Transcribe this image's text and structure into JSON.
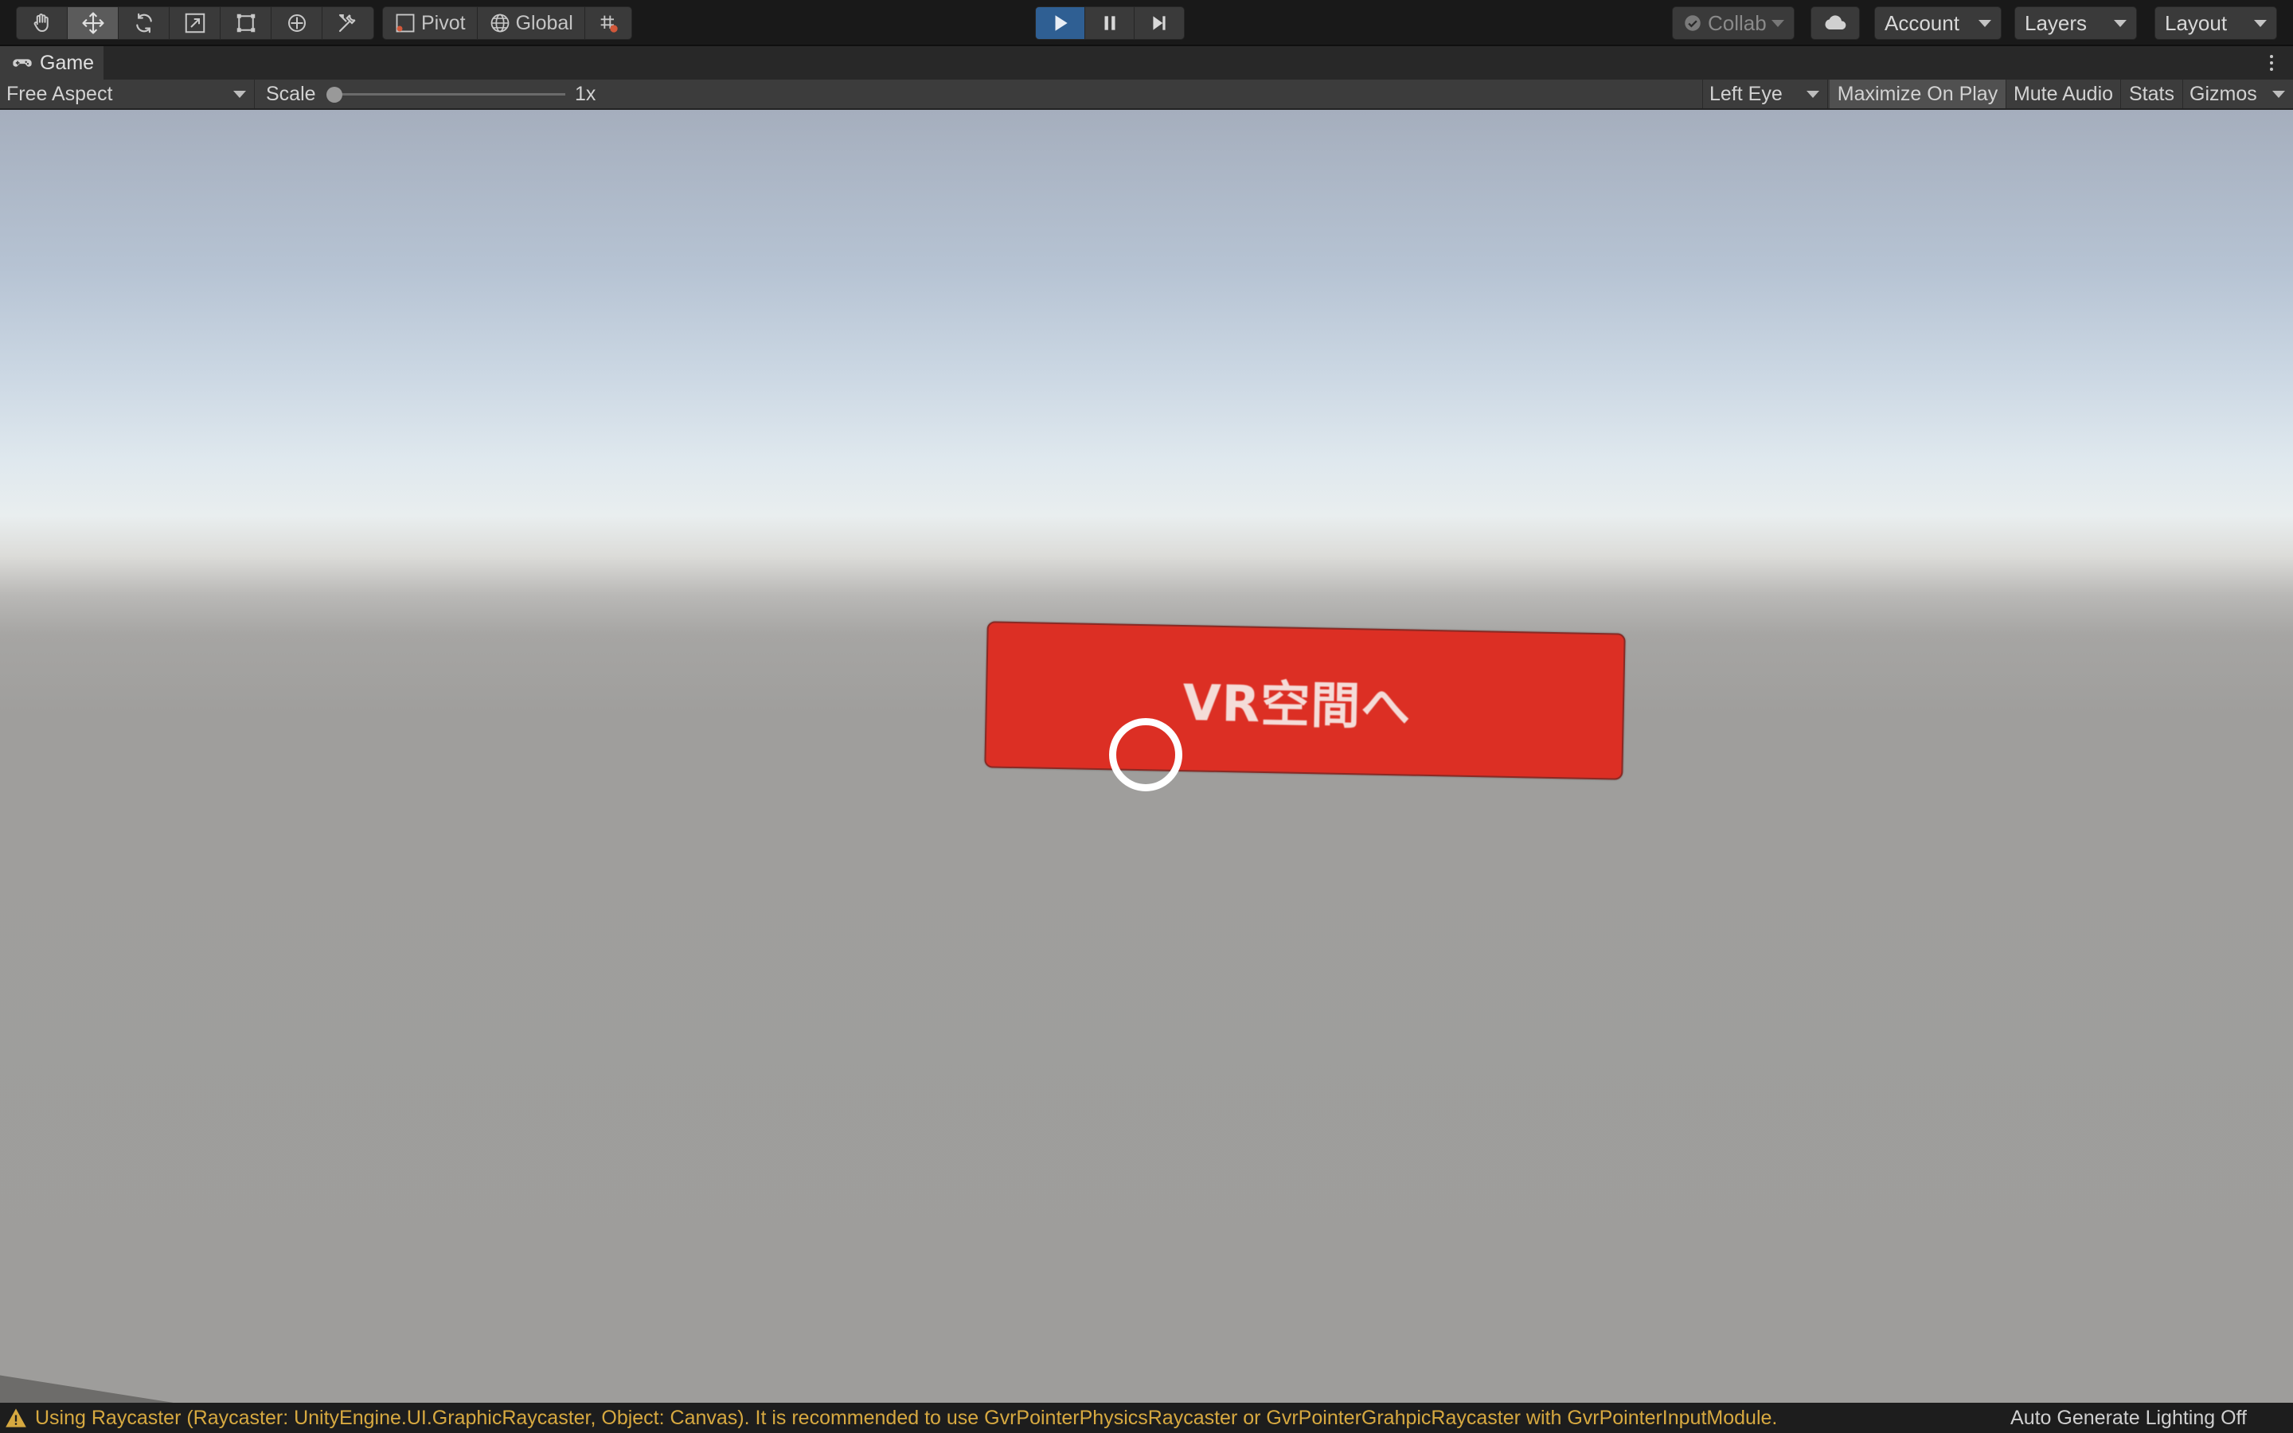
{
  "toolbar": {
    "tools": [
      "hand-tool",
      "move-tool",
      "rotate-tool",
      "scale-tool",
      "rect-tool",
      "transform-tool",
      "custom-tool"
    ],
    "pivot_label": "Pivot",
    "global_label": "Global",
    "collab_label": "Collab",
    "account_label": "Account",
    "layers_label": "Layers",
    "layout_label": "Layout",
    "play_state": "playing"
  },
  "tab": {
    "title": "Game"
  },
  "game_toolbar": {
    "aspect": "Free Aspect",
    "scale_label": "Scale",
    "scale_value": "1x",
    "eye": "Left Eye",
    "maximize": "Maximize On Play",
    "mute": "Mute Audio",
    "stats": "Stats",
    "gizmos": "Gizmos"
  },
  "scene": {
    "button_label": "VR空間へ",
    "button_color": "#dc2f24"
  },
  "status": {
    "message": "Using Raycaster (Raycaster: UnityEngine.UI.GraphicRaycaster, Object: Canvas). It is recommended to use GvrPointerPhysicsRaycaster or GvrPointerGrahpicRaycaster with GvrPointerInputModule.",
    "right": "Auto Generate Lighting Off",
    "warning_color": "#d7a940"
  },
  "colors": {
    "accent_play": "#2f5f93",
    "toolbar_bg": "#191919",
    "panel_bg": "#3c3c3c"
  }
}
